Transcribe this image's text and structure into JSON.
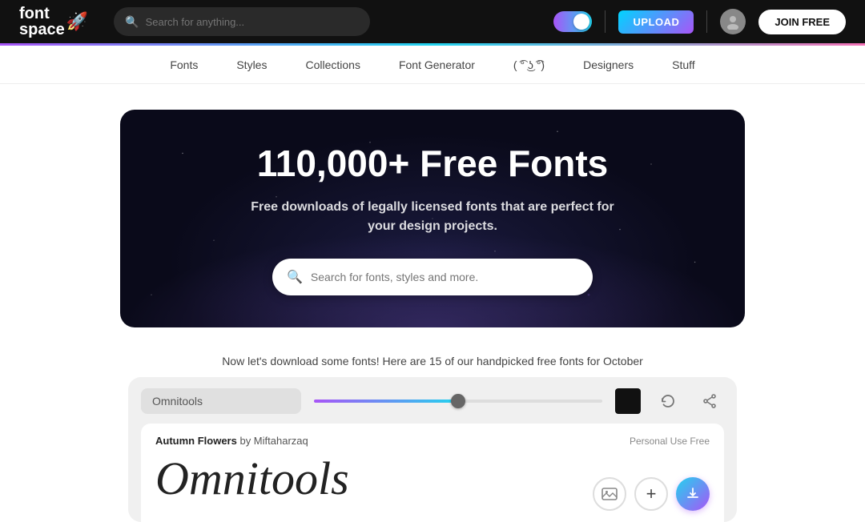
{
  "header": {
    "logo_text": "font",
    "logo_text2": "space",
    "logo_emoji": "🚀",
    "search_placeholder": "Search for anything...",
    "upload_label": "UPLOAD",
    "join_label": "JOIN FREE"
  },
  "nav": {
    "items": [
      {
        "label": "Fonts",
        "id": "nav-fonts"
      },
      {
        "label": "Styles",
        "id": "nav-styles"
      },
      {
        "label": "Collections",
        "id": "nav-collections"
      },
      {
        "label": "Font Generator",
        "id": "nav-generator"
      },
      {
        "label": "( ͡° ͜ʖ ͡°)",
        "id": "nav-emoji"
      },
      {
        "label": "Designers",
        "id": "nav-designers"
      },
      {
        "label": "Stuff",
        "id": "nav-stuff"
      }
    ]
  },
  "hero": {
    "title": "110,000+ Free Fonts",
    "subtitle": "Free downloads of legally licensed fonts that are perfect for your design projects.",
    "search_placeholder": "Search for fonts, styles and more."
  },
  "section": {
    "label": "Now let's download some fonts! Here are 15 of our handpicked free fonts for October"
  },
  "font_widget": {
    "preview_text": "Omnitools",
    "font_name": "Autumn Flowers",
    "font_author": "by Miftaharzaq",
    "font_license": "Personal Use Free",
    "preview_display": "Omnitools"
  }
}
